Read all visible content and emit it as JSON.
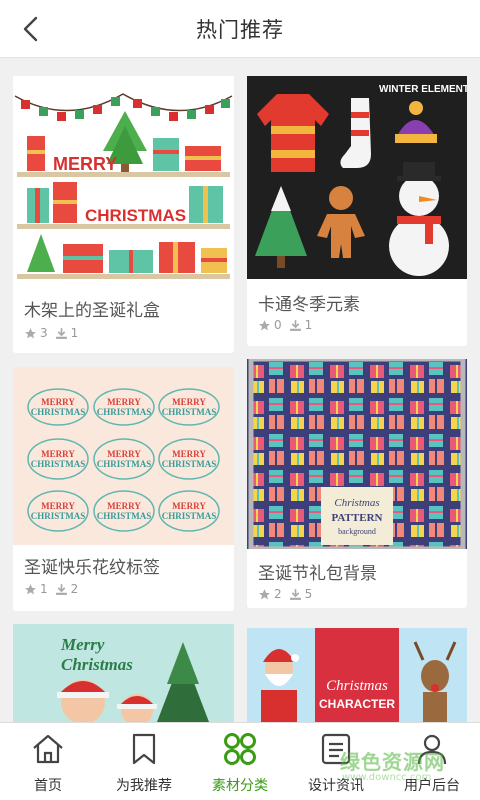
{
  "header": {
    "title": "热门推荐",
    "back_icon": "chevron-left-icon"
  },
  "cards": [
    {
      "title": "木架上的圣诞礼盒",
      "likes": "3",
      "downloads": "1",
      "thumb_text": [
        "MERRY",
        "CHRISTMAS"
      ]
    },
    {
      "title": "卡通冬季元素",
      "likes": "0",
      "downloads": "1",
      "thumb_text": [
        "WINTER ELEMENTS"
      ]
    },
    {
      "title": "圣诞快乐花纹标签",
      "likes": "1",
      "downloads": "2",
      "thumb_text": [
        "MERRY",
        "CHRISTMAS"
      ]
    },
    {
      "title": "圣诞节礼包背景",
      "likes": "2",
      "downloads": "5",
      "thumb_text": [
        "Christmas",
        "PATTERN",
        "background"
      ]
    },
    {
      "title": "",
      "thumb_text": [
        "Merry",
        "Christmas"
      ]
    },
    {
      "title": "",
      "thumb_text": [
        "Christmas",
        "CHARACTER"
      ]
    }
  ],
  "nav": [
    {
      "label": "首页",
      "icon": "home-icon",
      "active": false
    },
    {
      "label": "为我推荐",
      "icon": "bookmark-icon",
      "active": false
    },
    {
      "label": "素材分类",
      "icon": "grid-icon",
      "active": true
    },
    {
      "label": "设计资讯",
      "icon": "news-icon",
      "active": false
    },
    {
      "label": "用户后台",
      "icon": "user-icon",
      "active": false
    }
  ],
  "watermark": {
    "text": "绿色资源网",
    "url": "www.downcc.com"
  },
  "colors": {
    "accent": "#3a9c13",
    "background": "#f0f0f0",
    "icon_gray": "#aaaaaa"
  }
}
